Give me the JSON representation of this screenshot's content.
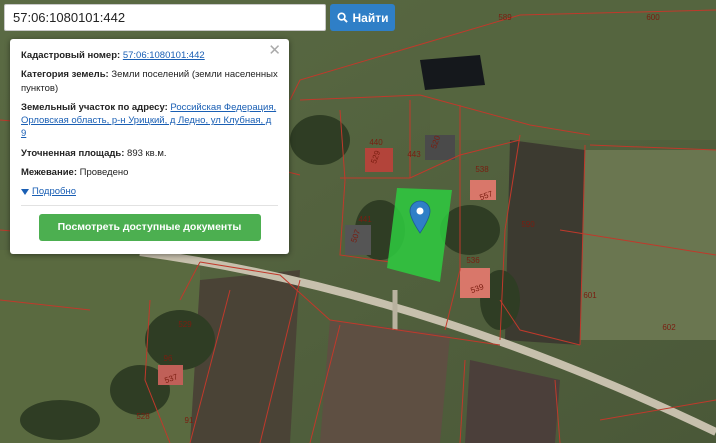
{
  "search": {
    "value": "57:06:1080101:442",
    "button_label": "Найти",
    "icon": "search-icon"
  },
  "popup": {
    "close_icon": "close-icon",
    "cadastral_label": "Кадастровый номер:",
    "cadastral_value": "57:06:1080101:442",
    "category_label": "Категория земель:",
    "category_value": "Земли поселений (земли населенных пунктов)",
    "address_label": "Земельный участок по адресу:",
    "address_value": "Российская Федерация, Орловская область, р-н Урицкий, д Ледно, ул Клубная, д 9",
    "area_label": "Уточненная площадь:",
    "area_value": "893 кв.м.",
    "survey_label": "Межевание:",
    "survey_value": "Проведено",
    "more_label": "Подробно",
    "more_icon": "triangle-down-icon",
    "docs_button": "Посмотреть доступные документы"
  },
  "map": {
    "marker_icon": "map-pin-icon",
    "highlight_color": "#2ecc40",
    "parcel_border_color": "#c0392b",
    "parcel_labels": [
      "589",
      "600",
      "440",
      "529",
      "443",
      "520",
      "538",
      "557",
      "441",
      "507",
      "590",
      "536",
      "539",
      "601",
      "602",
      "529",
      "96",
      "537",
      "528",
      "91"
    ]
  }
}
